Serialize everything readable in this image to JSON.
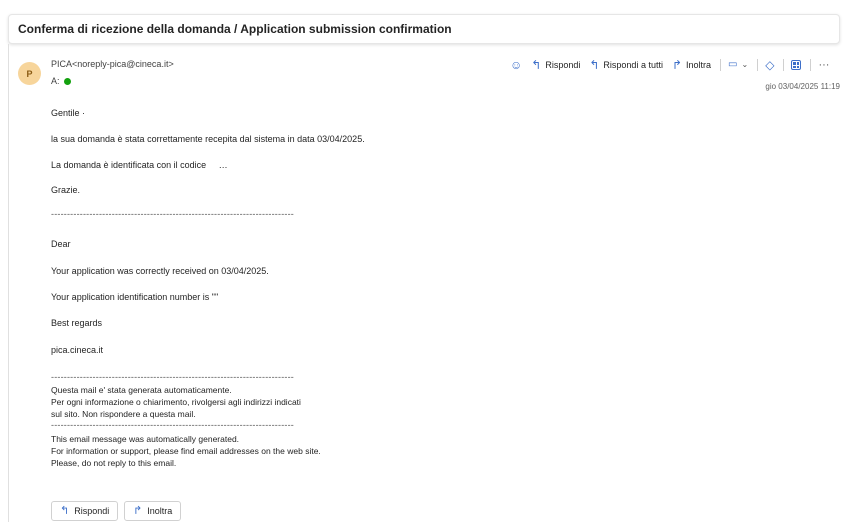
{
  "email": {
    "subject": "Conferma di ricezione della domanda / Application submission confirmation",
    "avatar_initial": "P",
    "sender": "PICA<noreply-pica@cineca.it>",
    "to_label": "A:",
    "date": "gio 03/04/2025 11:19"
  },
  "toolbar": {
    "reply": "Rispondi",
    "reply_all": "Rispondi a tutti",
    "forward": "Inoltra",
    "more": "···"
  },
  "body": {
    "greeting_it": "Gentile ·",
    "line1_it": "la sua domanda è stata correttamente recepita dal sistema in data 03/04/2025.",
    "line2_it": "La domanda è identificata con il codice",
    "code_placeholder": "…",
    "thanks_it": "Grazie.",
    "separator": "----------------------------------------------------------------------------",
    "greeting_en": "Dear",
    "line1_en": "Your application was correctly received on 03/04/2025.",
    "line2_en": "Your application identification number is \"\"",
    "regards_en": "Best regards",
    "site": "pica.cineca.it",
    "footer_it_1": "Questa mail e' stata generata automaticamente.",
    "footer_it_2": "Per ogni informazione o chiarimento, rivolgersi agli indirizzi indicati",
    "footer_it_3": "sul sito. Non rispondere a questa mail.",
    "footer_en_1": "This email message was automatically generated.",
    "footer_en_2": "For information or support, please find email addresses on the web site.",
    "footer_en_3": "Please, do not reply to this email."
  },
  "bottom_buttons": {
    "reply": "Rispondi",
    "forward": "Inoltra"
  }
}
